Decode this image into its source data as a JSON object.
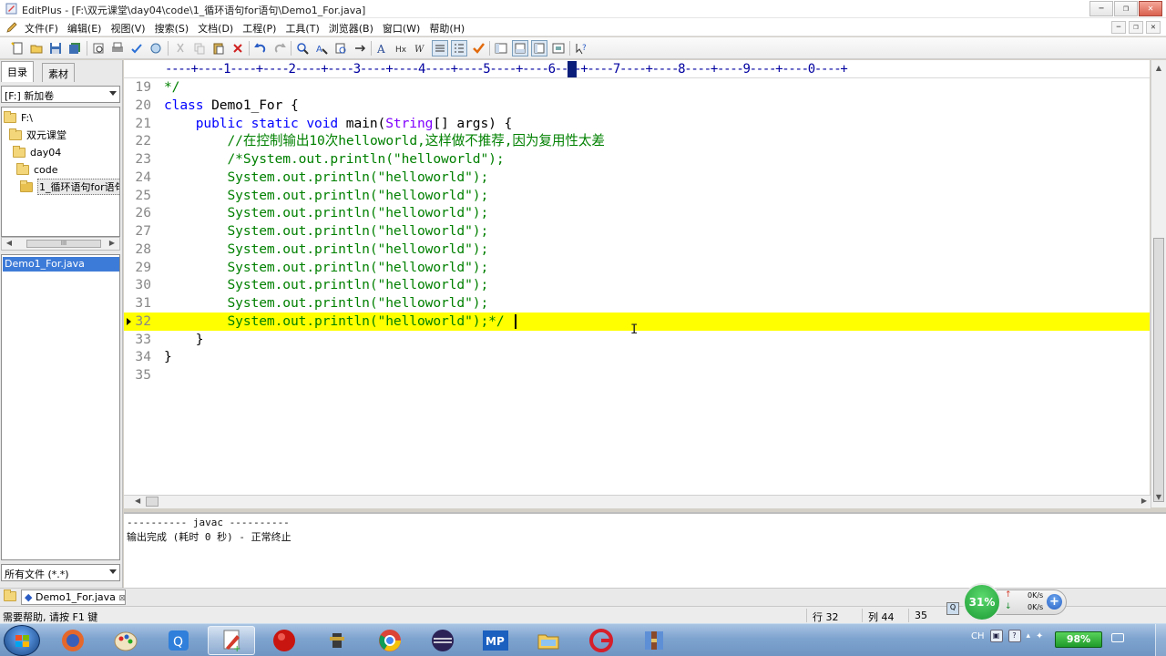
{
  "window": {
    "title": "EditPlus - [F:\\双元课堂\\day04\\code\\1_循环语句for语句\\Demo1_For.java]",
    "minimize": "−",
    "restore": "❐",
    "close": "✕"
  },
  "menu": {
    "items": [
      "文件(F)",
      "编辑(E)",
      "视图(V)",
      "搜索(S)",
      "文档(D)",
      "工程(P)",
      "工具(T)",
      "浏览器(B)",
      "窗口(W)",
      "帮助(H)"
    ],
    "mdi": [
      "−",
      "❐",
      "✕"
    ]
  },
  "panel": {
    "tabs": [
      "目录",
      "素材"
    ],
    "drive": "[F:] 新加卷",
    "tree": [
      "F:\\",
      "双元课堂",
      "day04",
      "code",
      "1_循环语句for语句"
    ],
    "scroll_thumb": "III",
    "files": [
      "Demo1_For.java"
    ],
    "filter": "所有文件 (*.*)"
  },
  "editor": {
    "ruler": "----+----1----+----2----+----3----+----4----+----5----+----6----+----7----+----8----+----9----+----0----+",
    "lines": [
      {
        "n": "19",
        "text": "*/",
        "kind": "comment"
      },
      {
        "n": "20",
        "text": "class Demo1_For {",
        "kind": "code"
      },
      {
        "n": "21",
        "text": "    public static void main(String[] args) {",
        "kind": "code"
      },
      {
        "n": "22",
        "text": "        //在控制输出10次helloworld,这样做不推荐,因为复用性太差",
        "kind": "comment"
      },
      {
        "n": "23",
        "text": "        /*System.out.println(\"helloworld\");",
        "kind": "comment"
      },
      {
        "n": "24",
        "text": "        System.out.println(\"helloworld\");",
        "kind": "comment"
      },
      {
        "n": "25",
        "text": "        System.out.println(\"helloworld\");",
        "kind": "comment"
      },
      {
        "n": "26",
        "text": "        System.out.println(\"helloworld\");",
        "kind": "comment"
      },
      {
        "n": "27",
        "text": "        System.out.println(\"helloworld\");",
        "kind": "comment"
      },
      {
        "n": "28",
        "text": "        System.out.println(\"helloworld\");",
        "kind": "comment"
      },
      {
        "n": "29",
        "text": "        System.out.println(\"helloworld\");",
        "kind": "comment"
      },
      {
        "n": "30",
        "text": "        System.out.println(\"helloworld\");",
        "kind": "comment"
      },
      {
        "n": "31",
        "text": "        System.out.println(\"helloworld\");",
        "kind": "comment"
      },
      {
        "n": "32",
        "text": "        System.out.println(\"helloworld\");*/",
        "kind": "comment"
      },
      {
        "n": "33",
        "text": "    }",
        "kind": "code"
      },
      {
        "n": "34",
        "text": "}",
        "kind": "code"
      },
      {
        "n": "35",
        "text": "",
        "kind": "code"
      }
    ],
    "current_line": "32",
    "highlight_color": "#ffff00",
    "comment_color": "#008000",
    "keyword_color": "#0000ff",
    "linenum_color": "#888888"
  },
  "output": {
    "lines": [
      "---------- javac ----------",
      "输出完成 (耗时 0 秒) - 正常终止"
    ]
  },
  "doc_tabs": [
    "Demo1_For.java"
  ],
  "status": {
    "help": "需要帮助, 请按 F1 键",
    "row": "行 32",
    "col": "列 44",
    "num": "35"
  },
  "net": {
    "percent": "31%",
    "up": "0K/s",
    "down": "0K/s"
  },
  "taskbar": {
    "apps": [
      "firefox-icon",
      "qq-icon",
      "paint-icon",
      "qq-browser-icon",
      "editplus-icon",
      "record-icon",
      "ftp-icon",
      "chrome-icon",
      "eclipse-icon",
      "mp-icon",
      "explorer-icon",
      "grapecity-icon",
      "archive-icon"
    ],
    "tray_lang": "CH",
    "battery": "98%"
  }
}
